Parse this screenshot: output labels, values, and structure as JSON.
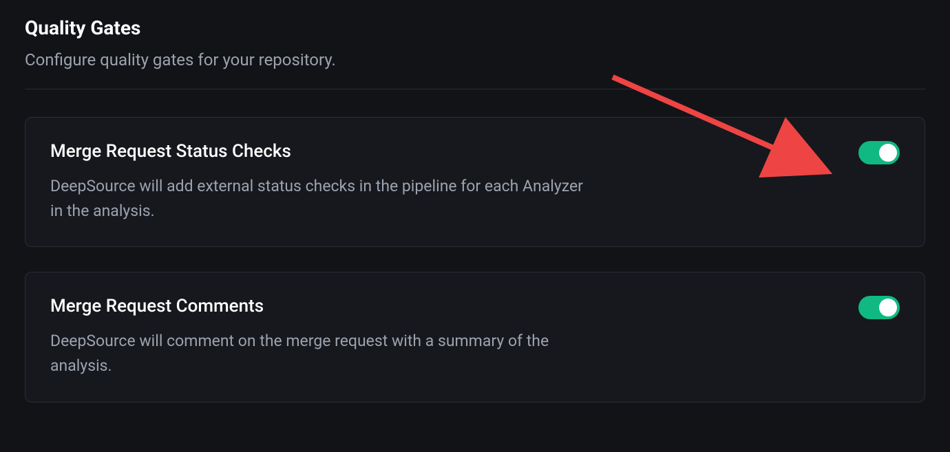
{
  "header": {
    "title": "Quality Gates",
    "subtitle": "Configure quality gates for your repository."
  },
  "settings": [
    {
      "id": "merge-request-status-checks",
      "title": "Merge Request Status Checks",
      "description": "DeepSource will add external status checks in the pipeline for each Analyzer in the analysis.",
      "enabled": true
    },
    {
      "id": "merge-request-comments",
      "title": "Merge Request Comments",
      "description": "DeepSource will comment on the merge request with a summary of the analysis.",
      "enabled": true
    }
  ],
  "colors": {
    "toggle_on": "#10b981",
    "arrow": "#ef4444"
  }
}
